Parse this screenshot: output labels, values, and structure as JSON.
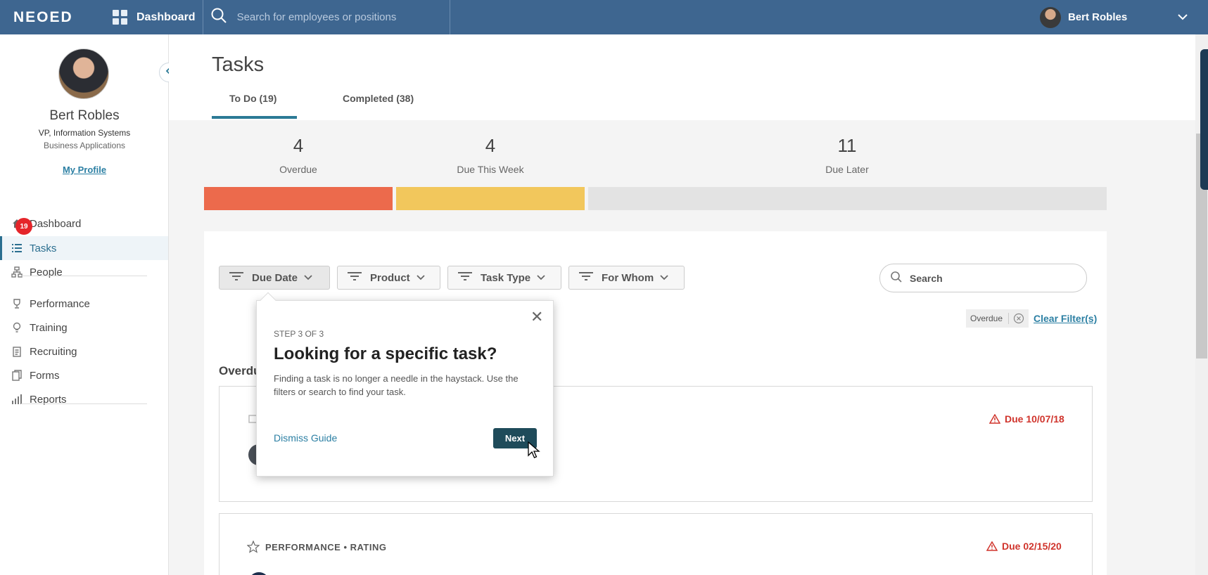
{
  "topbar": {
    "logo": "NEOED",
    "dashboard_label": "Dashboard",
    "search_placeholder": "Search for employees or positions",
    "user_name": "Bert Robles"
  },
  "sidebar": {
    "name": "Bert Robles",
    "title": "VP, Information Systems",
    "department": "Business Applications",
    "my_profile": "My Profile",
    "tasks_badge": "19",
    "items": [
      {
        "label": "Dashboard",
        "icon": "home-icon"
      },
      {
        "label": "Tasks",
        "icon": "list-icon",
        "active": true
      },
      {
        "label": "People",
        "icon": "org-chart-icon"
      },
      {
        "label": "Performance",
        "icon": "trophy-icon"
      },
      {
        "label": "Training",
        "icon": "lightbulb-icon"
      },
      {
        "label": "Recruiting",
        "icon": "clipboard-icon"
      },
      {
        "label": "Forms",
        "icon": "forms-icon"
      },
      {
        "label": "Reports",
        "icon": "bar-chart-icon"
      }
    ]
  },
  "page": {
    "title": "Tasks",
    "tabs": [
      "To Do (19)",
      "Completed (38)"
    ]
  },
  "stats": [
    {
      "count": "4",
      "label": "Overdue",
      "color": "#ec6a4c"
    },
    {
      "count": "4",
      "label": "Due This Week",
      "color": "#f2c75c"
    },
    {
      "count": "11",
      "label": "Due Later",
      "color": "#e3e3e3"
    }
  ],
  "filters": [
    "Due Date",
    "Product",
    "Task Type",
    "For Whom"
  ],
  "search": {
    "placeholder": "Search"
  },
  "active_filter_chip": "Overdue",
  "clear_filters": "Clear Filter(s)",
  "section_title": "Overdu",
  "cards": [
    {
      "due": "Due 10/07/18"
    },
    {
      "category": "PERFORMANCE • RATING",
      "due": "Due 02/15/20"
    }
  ],
  "guide": {
    "step": "STEP 3 OF 3",
    "title": "Looking for a specific task?",
    "body": "Finding a task is no longer a needle in the haystack. Use the filters or search to find your task.",
    "dismiss": "Dismiss Guide",
    "next": "Next"
  },
  "colors": {
    "topbar": "#3e6690",
    "accent": "#2c7a96",
    "overdue": "#d0342c"
  }
}
